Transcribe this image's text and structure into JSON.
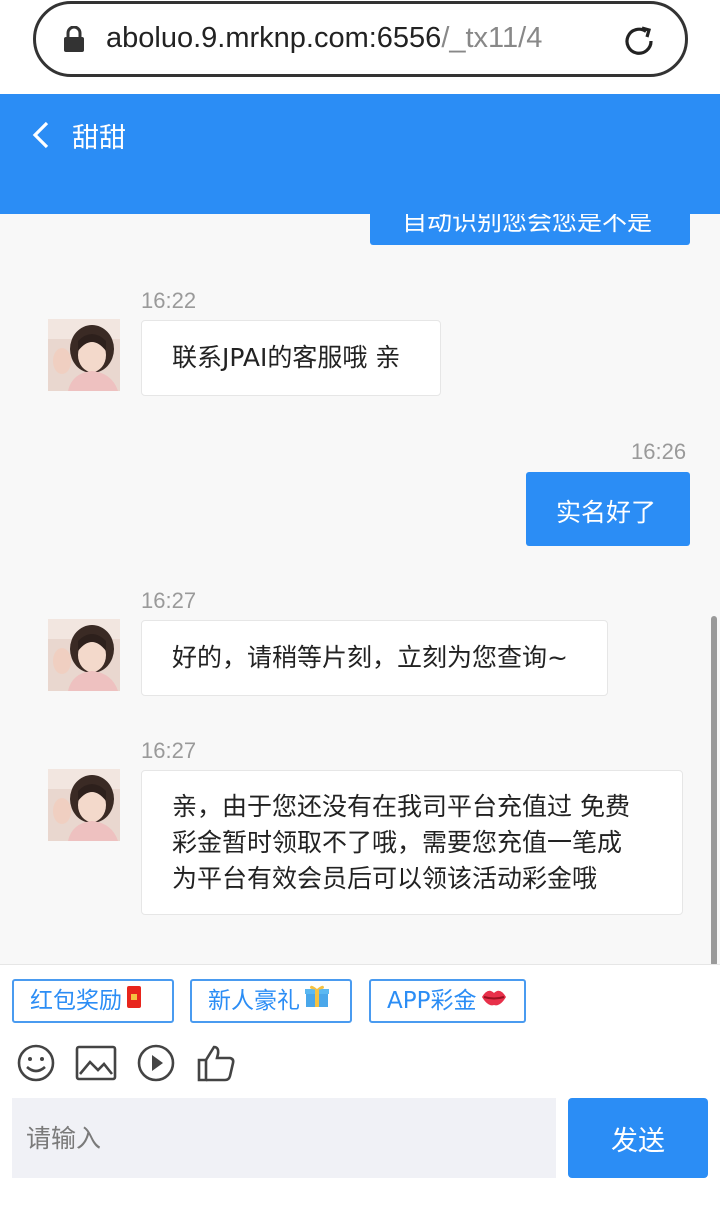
{
  "browser": {
    "url_host": "aboluo.9.mrknp.com:6556",
    "url_path": "/_tx11/4"
  },
  "header": {
    "title": "甜甜"
  },
  "chat": {
    "partial_message": "自动识别您会您是不是",
    "messages": [
      {
        "time": "16:22",
        "text": "联系JPAI的客服哦 亲"
      },
      {
        "time": "16:26",
        "text": "实名好了"
      },
      {
        "time": "16:27",
        "text": "好的，请稍等片刻，立刻为您查询~"
      },
      {
        "time": "16:27",
        "lines": [
          "亲，由于您还没有在我司平台充值过 免费",
          "彩金暂时领取不了哦，需要您充值一笔成",
          "为平台有效会员后可以领该活动彩金哦"
        ]
      }
    ]
  },
  "quick_replies": [
    {
      "label": "红包奖励",
      "emoji": "🧧"
    },
    {
      "label": "新人豪礼",
      "emoji": "🎁"
    },
    {
      "label": "APP彩金",
      "emoji": "💋"
    }
  ],
  "toolbar_icons": [
    "smiley-icon",
    "image-icon",
    "play-icon",
    "thumbs-up-icon"
  ],
  "composer": {
    "placeholder": "请输入",
    "send_label": "发送"
  },
  "colors": {
    "accent": "#2b8df5",
    "chat_bg": "#f8f8f8"
  }
}
